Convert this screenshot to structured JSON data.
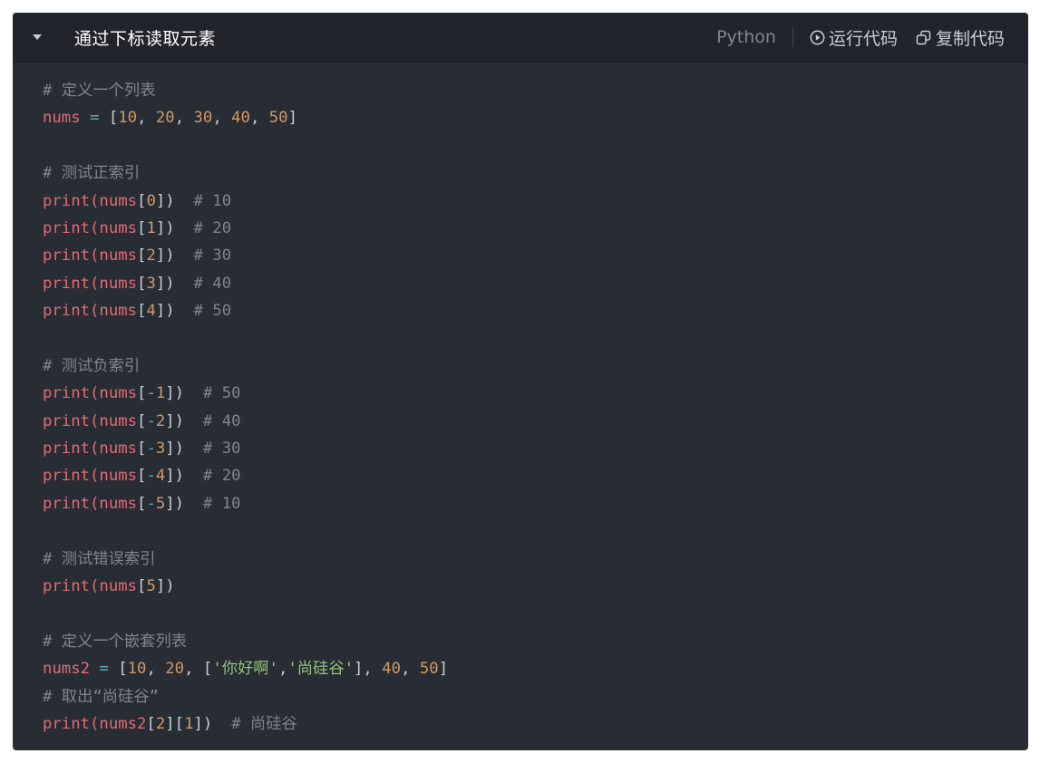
{
  "header": {
    "title": "通过下标读取元素",
    "language": "Python",
    "run_label": "运行代码",
    "copy_label": "复制代码"
  },
  "code": {
    "lines": [
      [
        {
          "t": "cm",
          "s": "# 定义一个列表"
        }
      ],
      [
        {
          "t": "vr",
          "s": "nums"
        },
        {
          "t": "op",
          "s": " = "
        },
        {
          "t": "pn",
          "s": "["
        },
        {
          "t": "nm",
          "s": "10"
        },
        {
          "t": "pn",
          "s": ", "
        },
        {
          "t": "nm",
          "s": "20"
        },
        {
          "t": "pn",
          "s": ", "
        },
        {
          "t": "nm",
          "s": "30"
        },
        {
          "t": "pn",
          "s": ", "
        },
        {
          "t": "nm",
          "s": "40"
        },
        {
          "t": "pn",
          "s": ", "
        },
        {
          "t": "nm",
          "s": "50"
        },
        {
          "t": "pn",
          "s": "]"
        }
      ],
      [],
      [
        {
          "t": "cm",
          "s": "# 测试正索引"
        }
      ],
      [
        {
          "t": "vr",
          "s": "print(nums"
        },
        {
          "t": "pn",
          "s": "["
        },
        {
          "t": "nm",
          "s": "0"
        },
        {
          "t": "pn",
          "s": "])"
        },
        {
          "t": "pn",
          "s": "  "
        },
        {
          "t": "cm",
          "s": "# 10"
        }
      ],
      [
        {
          "t": "vr",
          "s": "print(nums"
        },
        {
          "t": "pn",
          "s": "["
        },
        {
          "t": "nm",
          "s": "1"
        },
        {
          "t": "pn",
          "s": "])"
        },
        {
          "t": "pn",
          "s": "  "
        },
        {
          "t": "cm",
          "s": "# 20"
        }
      ],
      [
        {
          "t": "vr",
          "s": "print(nums"
        },
        {
          "t": "pn",
          "s": "["
        },
        {
          "t": "nm",
          "s": "2"
        },
        {
          "t": "pn",
          "s": "])"
        },
        {
          "t": "pn",
          "s": "  "
        },
        {
          "t": "cm",
          "s": "# 30"
        }
      ],
      [
        {
          "t": "vr",
          "s": "print(nums"
        },
        {
          "t": "pn",
          "s": "["
        },
        {
          "t": "nm",
          "s": "3"
        },
        {
          "t": "pn",
          "s": "])"
        },
        {
          "t": "pn",
          "s": "  "
        },
        {
          "t": "cm",
          "s": "# 40"
        }
      ],
      [
        {
          "t": "vr",
          "s": "print(nums"
        },
        {
          "t": "pn",
          "s": "["
        },
        {
          "t": "nm",
          "s": "4"
        },
        {
          "t": "pn",
          "s": "])"
        },
        {
          "t": "pn",
          "s": "  "
        },
        {
          "t": "cm",
          "s": "# 50"
        }
      ],
      [],
      [
        {
          "t": "cm",
          "s": "# 测试负索引"
        }
      ],
      [
        {
          "t": "vr",
          "s": "print(nums"
        },
        {
          "t": "pn",
          "s": "["
        },
        {
          "t": "op",
          "s": "-"
        },
        {
          "t": "nm",
          "s": "1"
        },
        {
          "t": "pn",
          "s": "])"
        },
        {
          "t": "pn",
          "s": "  "
        },
        {
          "t": "cm",
          "s": "# 50"
        }
      ],
      [
        {
          "t": "vr",
          "s": "print(nums"
        },
        {
          "t": "pn",
          "s": "["
        },
        {
          "t": "op",
          "s": "-"
        },
        {
          "t": "nm",
          "s": "2"
        },
        {
          "t": "pn",
          "s": "])"
        },
        {
          "t": "pn",
          "s": "  "
        },
        {
          "t": "cm",
          "s": "# 40"
        }
      ],
      [
        {
          "t": "vr",
          "s": "print(nums"
        },
        {
          "t": "pn",
          "s": "["
        },
        {
          "t": "op",
          "s": "-"
        },
        {
          "t": "nm",
          "s": "3"
        },
        {
          "t": "pn",
          "s": "])"
        },
        {
          "t": "pn",
          "s": "  "
        },
        {
          "t": "cm",
          "s": "# 30"
        }
      ],
      [
        {
          "t": "vr",
          "s": "print(nums"
        },
        {
          "t": "pn",
          "s": "["
        },
        {
          "t": "op",
          "s": "-"
        },
        {
          "t": "nm",
          "s": "4"
        },
        {
          "t": "pn",
          "s": "])"
        },
        {
          "t": "pn",
          "s": "  "
        },
        {
          "t": "cm",
          "s": "# 20"
        }
      ],
      [
        {
          "t": "vr",
          "s": "print(nums"
        },
        {
          "t": "pn",
          "s": "["
        },
        {
          "t": "op",
          "s": "-"
        },
        {
          "t": "nm",
          "s": "5"
        },
        {
          "t": "pn",
          "s": "])"
        },
        {
          "t": "pn",
          "s": "  "
        },
        {
          "t": "cm",
          "s": "# 10"
        }
      ],
      [],
      [
        {
          "t": "cm",
          "s": "# 测试错误索引"
        }
      ],
      [
        {
          "t": "vr",
          "s": "print(nums"
        },
        {
          "t": "pn",
          "s": "["
        },
        {
          "t": "nm",
          "s": "5"
        },
        {
          "t": "pn",
          "s": "])"
        }
      ],
      [],
      [
        {
          "t": "cm",
          "s": "# 定义一个嵌套列表"
        }
      ],
      [
        {
          "t": "vr",
          "s": "nums2"
        },
        {
          "t": "op",
          "s": " = "
        },
        {
          "t": "pn",
          "s": "["
        },
        {
          "t": "nm",
          "s": "10"
        },
        {
          "t": "pn",
          "s": ", "
        },
        {
          "t": "nm",
          "s": "20"
        },
        {
          "t": "pn",
          "s": ", ["
        },
        {
          "t": "st",
          "s": "'你好啊'"
        },
        {
          "t": "pn",
          "s": ","
        },
        {
          "t": "st",
          "s": "'尚硅谷'"
        },
        {
          "t": "pn",
          "s": "], "
        },
        {
          "t": "nm",
          "s": "40"
        },
        {
          "t": "pn",
          "s": ", "
        },
        {
          "t": "nm",
          "s": "50"
        },
        {
          "t": "pn",
          "s": "]"
        }
      ],
      [
        {
          "t": "cm",
          "s": "# 取出“尚硅谷”"
        }
      ],
      [
        {
          "t": "vr",
          "s": "print(nums2"
        },
        {
          "t": "pn",
          "s": "["
        },
        {
          "t": "nm",
          "s": "2"
        },
        {
          "t": "pn",
          "s": "]["
        },
        {
          "t": "nm",
          "s": "1"
        },
        {
          "t": "pn",
          "s": "])"
        },
        {
          "t": "pn",
          "s": "  "
        },
        {
          "t": "cm",
          "s": "# 尚硅谷"
        }
      ]
    ]
  },
  "colors": {
    "background": "#282c34",
    "header_background": "#21252b",
    "comment": "#7f848e",
    "keyword": "#e06c75",
    "operator": "#56b6c2",
    "number": "#d19a66",
    "string": "#98c379"
  },
  "icons": {
    "toggle": "caret-down-icon",
    "run": "play-circle-icon",
    "copy": "copy-icon"
  }
}
